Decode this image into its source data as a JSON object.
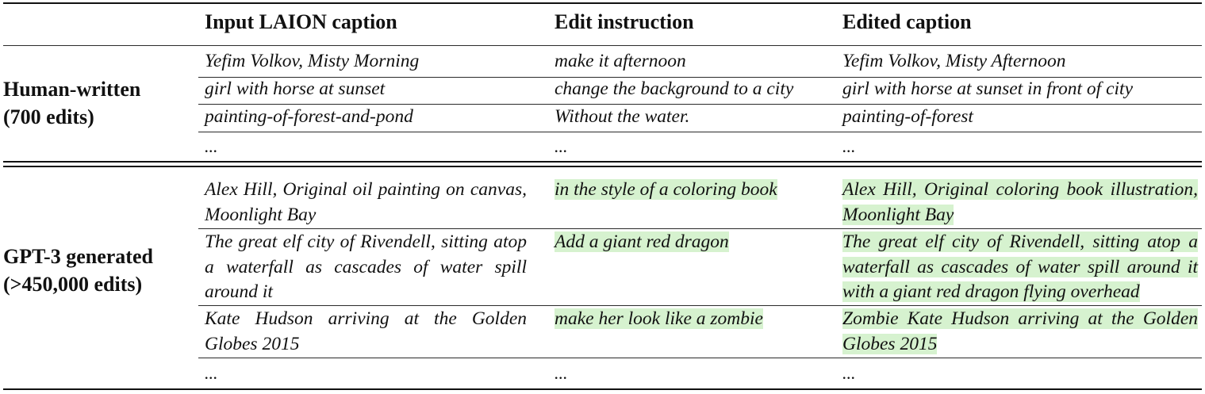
{
  "columns": [
    "",
    "Input LAION caption",
    "Edit instruction",
    "Edited caption"
  ],
  "groups": [
    {
      "label": [
        "Human-written",
        "(700 edits)"
      ],
      "rows": [
        {
          "input": "Yefim Volkov, Misty Morning",
          "instruction": "make it afternoon",
          "edited": "Yefim Volkov, Misty Afternoon"
        },
        {
          "input": "girl with horse at sunset",
          "instruction": "change the background to a city",
          "edited": "girl with horse at sunset in front of city"
        },
        {
          "input": "painting-of-forest-and-pond",
          "instruction": "Without the water.",
          "edited": "painting-of-forest"
        },
        {
          "input": "...",
          "instruction": "...",
          "edited": "..."
        }
      ]
    },
    {
      "label": [
        "GPT-3 generated",
        "(>450,000 edits)"
      ],
      "rows": [
        {
          "input": "Alex Hill, Original oil painting on canvas, Moonlight Bay",
          "instruction": "in the style of a coloring book",
          "edited": "Alex Hill, Original coloring book illustration, Moonlight Bay"
        },
        {
          "input": "The great elf city of Rivendell, sitting atop a waterfall as cascades of water spill around it",
          "instruction": "Add a giant red dragon",
          "edited": "The great elf city of Rivendell, sitting atop a waterfall as cascades of water spill around it with a giant red dragon flying overhead"
        },
        {
          "input": "Kate Hudson arriving at the Golden Globes 2015",
          "instruction": "make her look like a zombie",
          "edited": "Zombie Kate Hudson arriving at the Golden Globes 2015"
        },
        {
          "input": "...",
          "instruction": "...",
          "edited": "..."
        }
      ]
    }
  ],
  "highlight_color": "#d6f2cf"
}
